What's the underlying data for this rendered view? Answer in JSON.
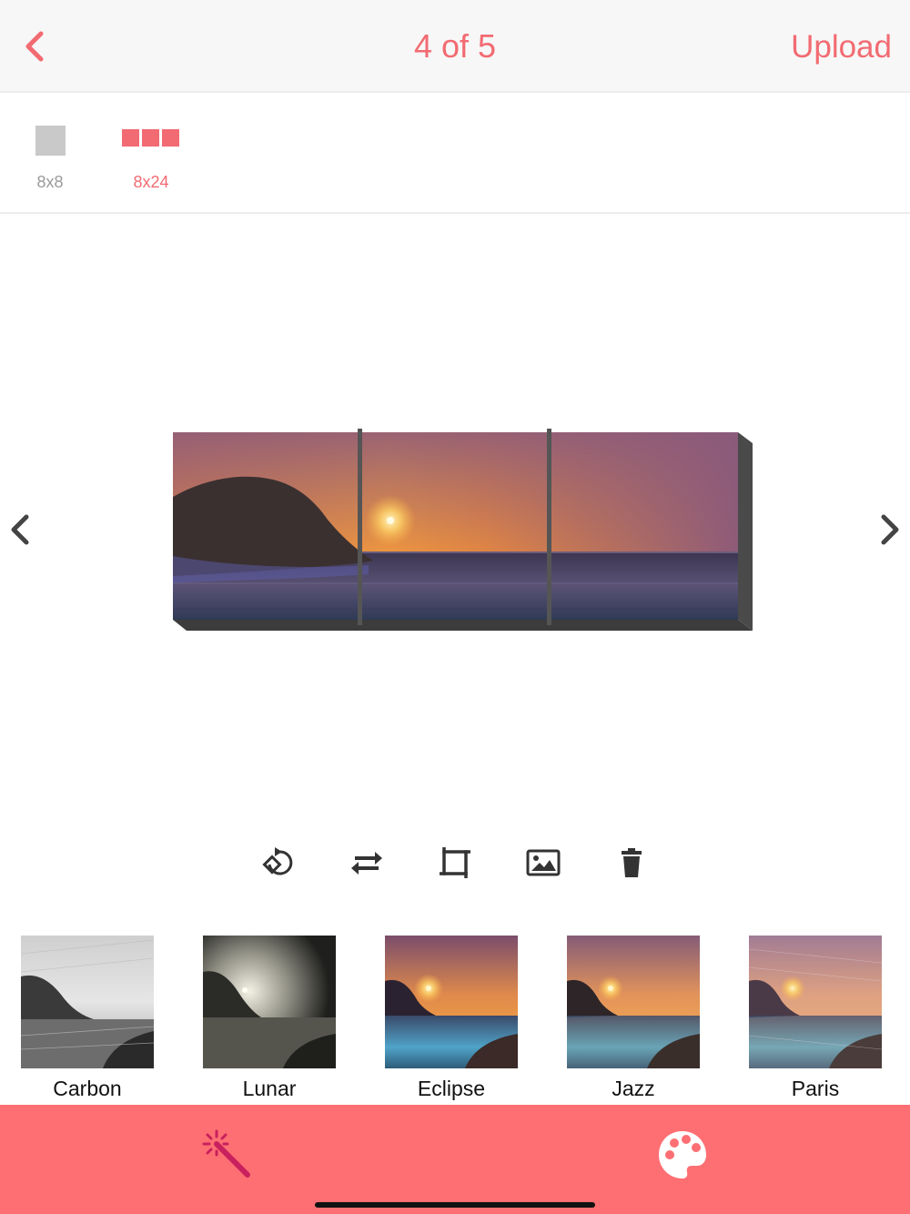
{
  "header": {
    "title": "4 of 5",
    "upload_label": "Upload"
  },
  "sizes": [
    {
      "label": "8x8",
      "selected": false
    },
    {
      "label": "8x24",
      "selected": true
    }
  ],
  "toolbar": {
    "icons": [
      "rotate-icon",
      "swap-icon",
      "crop-icon",
      "replace-image-icon",
      "trash-icon"
    ]
  },
  "filters": [
    {
      "name": "Carbon"
    },
    {
      "name": "Lunar"
    },
    {
      "name": "Eclipse"
    },
    {
      "name": "Jazz"
    },
    {
      "name": "Paris"
    }
  ],
  "bottom_tabs": {
    "icons": [
      "magic-wand-icon",
      "palette-icon"
    ]
  },
  "colors": {
    "accent": "#f26b72",
    "bottom_bar": "#fe6f73",
    "header_bg": "#f7f7f7",
    "inactive": "#c9c9c9"
  }
}
